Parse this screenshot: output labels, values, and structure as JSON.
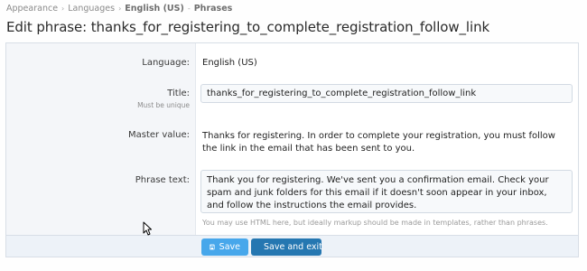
{
  "breadcrumb": {
    "items": [
      "Appearance",
      "Languages",
      "English (US)",
      "Phrases"
    ]
  },
  "page_title": "Edit phrase: thanks_for_registering_to_complete_registration_follow_link",
  "form": {
    "language": {
      "label": "Language:",
      "value": "English (US)"
    },
    "title": {
      "label": "Title:",
      "hint": "Must be unique",
      "value": "thanks_for_registering_to_complete_registration_follow_link"
    },
    "master_value": {
      "label": "Master value:",
      "value": "Thanks for registering. In order to complete your registration, you must follow the link in the email that has been sent to you."
    },
    "phrase_text": {
      "label": "Phrase text:",
      "value": "Thank you for registering. We've sent you a confirmation email. Check your spam and junk folders for this email if it doesn't soon appear in your inbox, and follow the instructions the email provides.",
      "explain": "You may use HTML here, but ideally markup should be made in templates, rather than phrases."
    }
  },
  "buttons": {
    "save": "Save",
    "save_exit": "Save and exit"
  },
  "colors": {
    "save_button": "#47a7eb",
    "save_exit_button": "#2577b1",
    "footer_bg": "#edf2f8"
  },
  "icons": [
    "chevron-right-icon",
    "save-icon",
    "mouse-cursor-icon"
  ]
}
